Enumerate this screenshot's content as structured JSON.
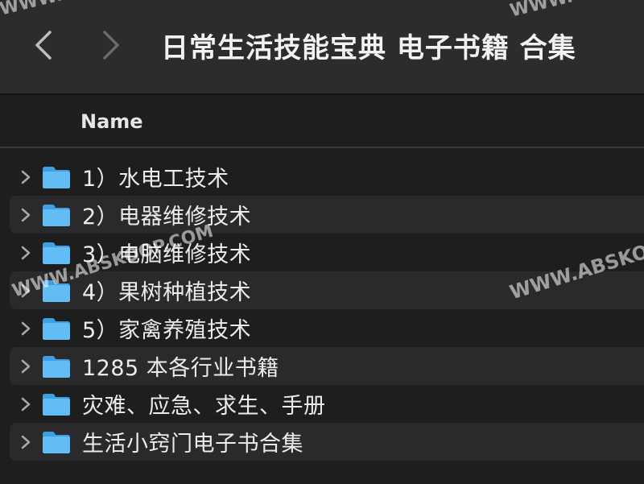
{
  "window": {
    "title": "日常生活技能宝典  电子书籍 合集"
  },
  "toolbar": {
    "back_icon": "chevron-left-icon",
    "forward_icon": "chevron-right-icon"
  },
  "columns": {
    "name_header": "Name"
  },
  "files": [
    {
      "label": "1）水电工技术",
      "icon": "folder-icon",
      "type": "folder"
    },
    {
      "label": "2）电器维修技术",
      "icon": "folder-icon",
      "type": "folder"
    },
    {
      "label": "3）电脑维修技术",
      "icon": "folder-icon",
      "type": "folder"
    },
    {
      "label": "4）果树种植技术",
      "icon": "folder-icon",
      "type": "folder"
    },
    {
      "label": "5）家禽养殖技术",
      "icon": "folder-icon",
      "type": "folder"
    },
    {
      "label": "1285 本各行业书籍",
      "icon": "folder-icon",
      "type": "folder"
    },
    {
      "label": "灾难、应急、求生、手册",
      "icon": "folder-icon",
      "type": "folder"
    },
    {
      "label": "生活小窍门电子书合集",
      "icon": "folder-icon",
      "type": "folder"
    }
  ],
  "watermarks": [
    "WWW.A",
    "WWW.",
    "WWW.ABSKOOP.COM",
    "WWW.ABSKO"
  ],
  "colors": {
    "background": "#1e1e1e",
    "toolbar": "#2c2c2e",
    "alt_row": "#2a2a2c",
    "folder_blue": "#5ab4f0"
  }
}
